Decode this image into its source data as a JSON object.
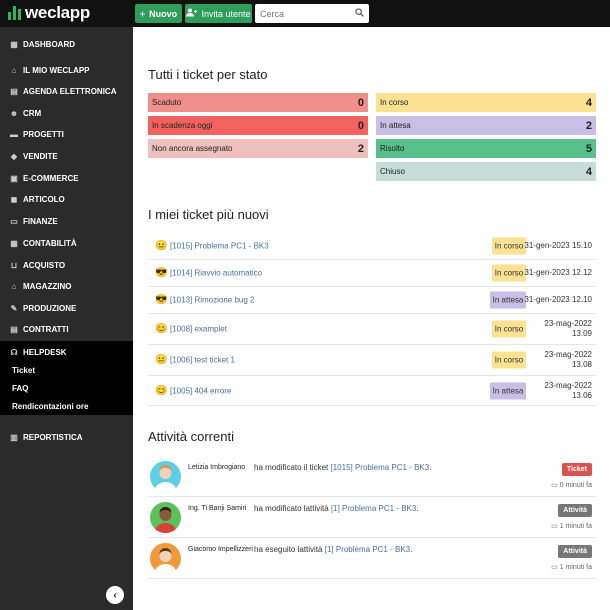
{
  "brand": {
    "name": "weclapp",
    "accent": "#2db55d"
  },
  "topbar": {
    "new_label": "Nuovo",
    "invite_label": "Invita utente",
    "search_placeholder": "Cerca"
  },
  "sidebar": {
    "items": [
      {
        "label": "DASHBOARD",
        "icon": "dashboard-icon"
      },
      {
        "label": "IL MIO WECLAPP",
        "icon": "home-icon"
      },
      {
        "label": "AGENDA ELETTRONICA",
        "icon": "inbox-icon"
      },
      {
        "label": "CRM",
        "icon": "users-icon"
      },
      {
        "label": "PROGETTI",
        "icon": "folder-icon"
      },
      {
        "label": "VENDITE",
        "icon": "tag-icon"
      },
      {
        "label": "E-COMMERCE",
        "icon": "shop-icon"
      },
      {
        "label": "ARTICOLO",
        "icon": "box-icon"
      },
      {
        "label": "FINANZE",
        "icon": "wallet-icon"
      },
      {
        "label": "CONTABILITÀ",
        "icon": "calculator-icon"
      },
      {
        "label": "ACQUISTO",
        "icon": "cart-icon"
      },
      {
        "label": "MAGAZZINO",
        "icon": "warehouse-icon"
      },
      {
        "label": "PRODUZIONE",
        "icon": "wrench-icon"
      },
      {
        "label": "CONTRATTI",
        "icon": "contract-icon"
      },
      {
        "label": "HELPDESK",
        "icon": "headset-icon"
      },
      {
        "label": "REPORTISTICA",
        "icon": "chart-icon"
      }
    ],
    "helpdesk_sub": [
      "Ticket",
      "FAQ",
      "Rendicontazioni ore"
    ]
  },
  "status_section": {
    "title": "Tutti i ticket per stato",
    "left": [
      {
        "label": "Scaduto",
        "count": "0",
        "color": "#f08f8c"
      },
      {
        "label": "In scadenza oggi",
        "count": "0",
        "color": "#f2635f"
      },
      {
        "label": "Non ancora assegnato",
        "count": "2",
        "color": "#efc0c0"
      }
    ],
    "right": [
      {
        "label": "In corso",
        "count": "4",
        "color": "#fbe293"
      },
      {
        "label": "In attesa",
        "count": "2",
        "color": "#c7bfe6"
      },
      {
        "label": "Risolto",
        "count": "5",
        "color": "#58c08b"
      },
      {
        "label": "Chiuso",
        "count": "4",
        "color": "#c5dcd8"
      }
    ]
  },
  "tickets_section": {
    "title": "I miei ticket più nuovi",
    "rows": [
      {
        "face": "😐",
        "title": "[1015] Problema PC1 - BK3",
        "status": "In corso",
        "status_color": "#fbe293",
        "date": "31-gen-2023 15.10"
      },
      {
        "face": "😎",
        "title": "[1014] Riavvio automatico",
        "status": "In corso",
        "status_color": "#fbe293",
        "date": "31-gen-2023 12.12"
      },
      {
        "face": "😎",
        "title": "[1013] Rimozione bug 2",
        "status": "In attesa",
        "status_color": "#c7bfe6",
        "date": "31-gen-2023 12.10"
      },
      {
        "face": "😊",
        "title": "[1008] examplet",
        "status": "In corso",
        "status_color": "#fbe293",
        "date": "23-mag-2022",
        "time": "13.09"
      },
      {
        "face": "😐",
        "title": "[1006] test ticket 1",
        "status": "In corso",
        "status_color": "#fbe293",
        "date": "23-mag-2022",
        "time": "13.08"
      },
      {
        "face": "😊",
        "title": "[1005] 404 errore",
        "status": "In attesa",
        "status_color": "#c7bfe6",
        "date": "23-mag-2022",
        "time": "13.06"
      }
    ]
  },
  "activity_section": {
    "title": "Attività correnti",
    "items": [
      {
        "name": "Letizia Imbrogiano",
        "action": "ha modificato il ticket",
        "link": "[1015] Problema PC1 - BK3",
        "suffix": ".",
        "badge": "Ticket",
        "badge_color": "#d9534f",
        "time": "0 minuti fa",
        "avatar_bg": "#5ccfe6"
      },
      {
        "name": "Ing. Ti Banji Samiri",
        "action": "ha modificato lattività",
        "link": "[1] Problema PC1 - BK3",
        "suffix": ".",
        "badge": "Attività",
        "badge_color": "#777777",
        "time": "1 minuti fa",
        "avatar_bg": "#5cc15c"
      },
      {
        "name": "Giacomo Impellizzeri",
        "action": "ha eseguito lattività",
        "link": "[1] Problema PC1 - BK3",
        "suffix": ".",
        "badge": "Attività",
        "badge_color": "#777777",
        "time": "1 minuti fa",
        "avatar_bg": "#f29a3a"
      }
    ]
  }
}
